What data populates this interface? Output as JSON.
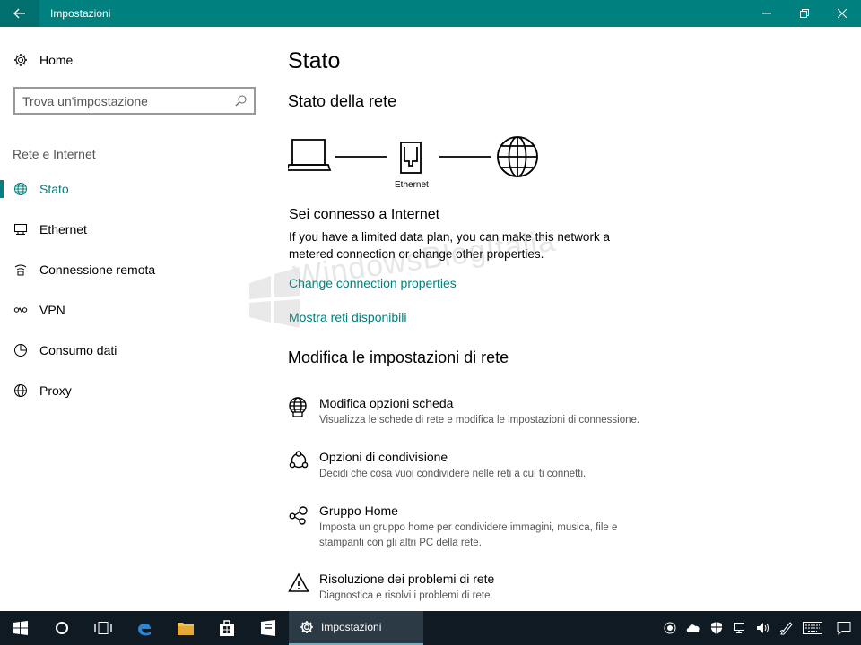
{
  "window": {
    "title": "Impostazioni"
  },
  "sidebar": {
    "home_label": "Home",
    "search_placeholder": "Trova un'impostazione",
    "section_title": "Rete e Internet",
    "items": [
      {
        "label": "Stato",
        "icon": "globe-icon",
        "active": true
      },
      {
        "label": "Ethernet",
        "icon": "ethernet-icon",
        "active": false
      },
      {
        "label": "Connessione remota",
        "icon": "dialup-icon",
        "active": false
      },
      {
        "label": "VPN",
        "icon": "vpn-icon",
        "active": false
      },
      {
        "label": "Consumo dati",
        "icon": "data-usage-icon",
        "active": false
      },
      {
        "label": "Proxy",
        "icon": "globe-icon",
        "active": false
      }
    ]
  },
  "main": {
    "page_title": "Stato",
    "network_status_title": "Stato della rete",
    "diagram_label": "Ethernet",
    "connection_title": "Sei connesso a Internet",
    "connection_desc": "If you have a limited data plan, you can make this network a metered connection or change other properties.",
    "link_change": "Change connection properties",
    "link_show": "Mostra reti disponibili",
    "settings_title": "Modifica le impostazioni di rete",
    "options": [
      {
        "title": "Modifica opzioni scheda",
        "desc": "Visualizza le schede di rete e modifica le impostazioni di connessione.",
        "icon": "adapter-icon"
      },
      {
        "title": "Opzioni di condivisione",
        "desc": "Decidi che cosa vuoi condividere nelle reti a cui ti connetti.",
        "icon": "sharing-icon"
      },
      {
        "title": "Gruppo Home",
        "desc": "Imposta un gruppo home per condividere immagini, musica, file e stampanti con gli altri PC della rete.",
        "icon": "homegroup-icon"
      },
      {
        "title": "Risoluzione dei problemi di rete",
        "desc": "Diagnostica e risolvi i problemi di rete.",
        "icon": "warning-icon"
      }
    ]
  },
  "watermark": "WindowsBlogItalia",
  "taskbar": {
    "active_app": "Impostazioni"
  },
  "colors": {
    "accent": "#00807f",
    "taskbar": "#101a22"
  }
}
